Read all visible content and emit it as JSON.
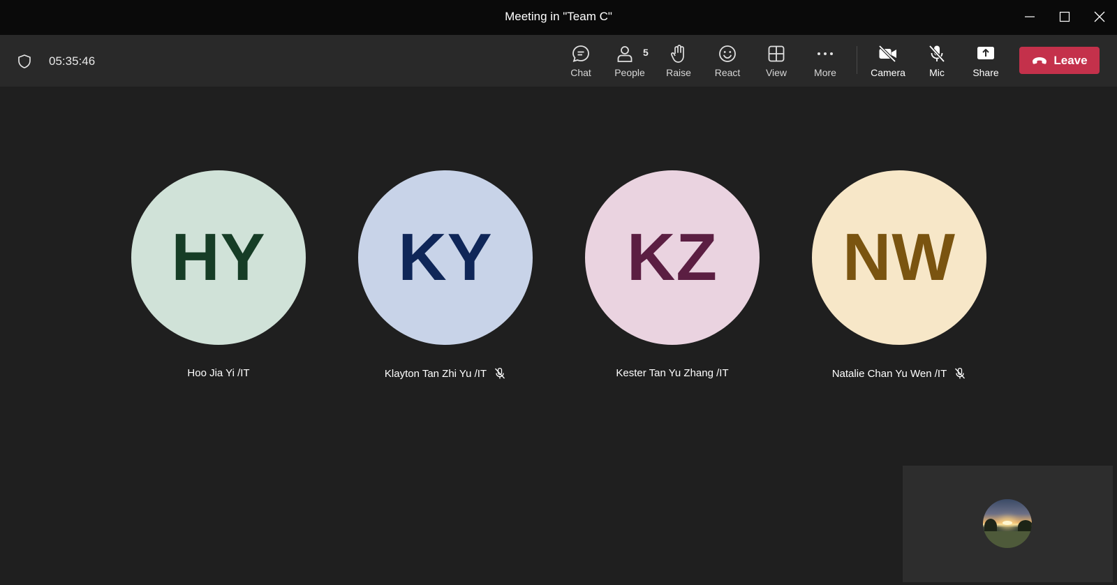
{
  "window": {
    "title": "Meeting in \"Team C\""
  },
  "toolbar": {
    "timer": "05:35:46",
    "buttons": {
      "chat": "Chat",
      "people": "People",
      "people_count": "5",
      "raise": "Raise",
      "react": "React",
      "view": "View",
      "more": "More",
      "camera": "Camera",
      "mic": "Mic",
      "share": "Share"
    },
    "leave": "Leave"
  },
  "participants": [
    {
      "initials": "HY",
      "name": "Hoo Jia Yi /IT",
      "muted": false,
      "bg": "#d0e2d8",
      "fg": "#163d26"
    },
    {
      "initials": "KY",
      "name": "Klayton Tan Zhi Yu /IT",
      "muted": true,
      "bg": "#c8d3e8",
      "fg": "#0f2658"
    },
    {
      "initials": "KZ",
      "name": "Kester Tan Yu Zhang /IT",
      "muted": false,
      "bg": "#ead3e0",
      "fg": "#5b1e42"
    },
    {
      "initials": "NW",
      "name": "Natalie Chan Yu Wen /IT",
      "muted": true,
      "bg": "#f7e7c8",
      "fg": "#7a5410"
    }
  ],
  "colors": {
    "leave_button": "#c4314b",
    "background": "#1f1f1f",
    "toolbar": "#292929"
  }
}
